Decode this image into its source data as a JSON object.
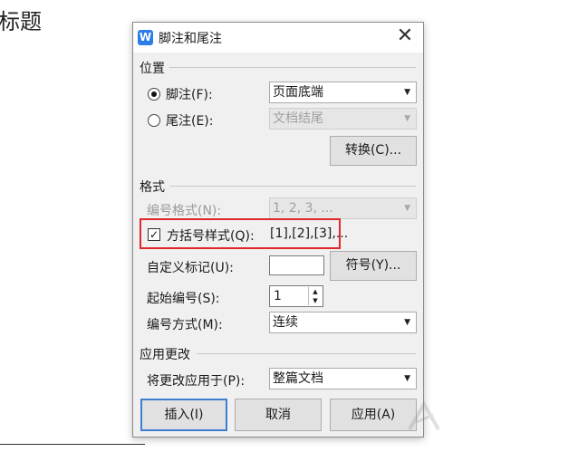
{
  "document": {
    "heading": "标题"
  },
  "dialog": {
    "title": "脚注和尾注",
    "app_icon_letter": "W",
    "close_glyph": "✕",
    "position": {
      "section_label": "位置",
      "footnote_label": "脚注(F):",
      "footnote_selected": true,
      "footnote_location": "页面底端",
      "endnote_label": "尾注(E):",
      "endnote_location": "文档结尾",
      "convert_button": "转换(C)..."
    },
    "format": {
      "section_label": "格式",
      "number_format_label": "编号格式(N):",
      "number_format_value": "1, 2, 3, ...",
      "bracket_style_label": "方括号样式(Q):",
      "bracket_style_checked": true,
      "bracket_style_preview": "[1],[2],[3],...",
      "custom_mark_label": "自定义标记(U):",
      "custom_mark_value": "",
      "symbol_button": "符号(Y)...",
      "start_number_label": "起始编号(S):",
      "start_number_value": "1",
      "numbering_label": "编号方式(M):",
      "numbering_value": "连续"
    },
    "apply_changes": {
      "section_label": "应用更改",
      "apply_to_label": "将更改应用于(P):",
      "apply_to_value": "整篇文档"
    },
    "buttons": {
      "insert": "插入(I)",
      "cancel": "取消",
      "apply": "应用(A)"
    }
  },
  "colors": {
    "highlight_box": "#e0272b",
    "default_button_border": "#3c7fd2",
    "app_icon": "#2b7de9"
  }
}
